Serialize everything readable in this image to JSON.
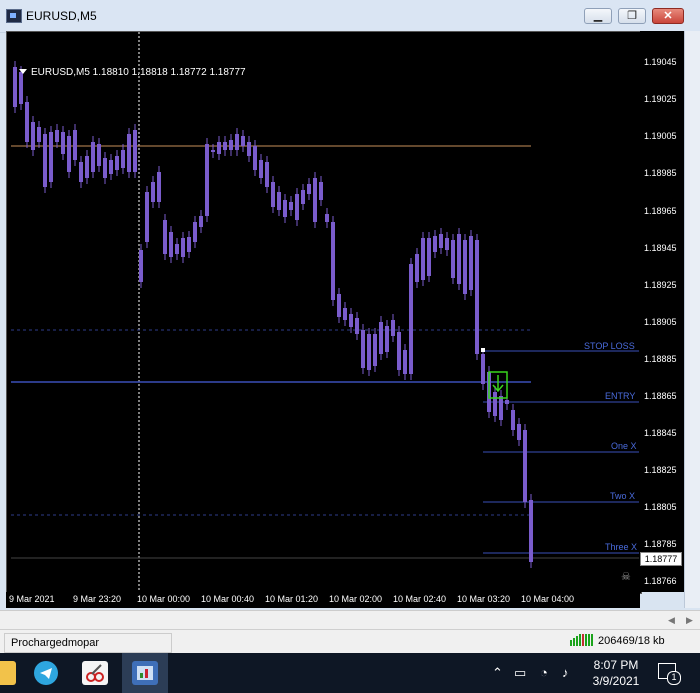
{
  "window": {
    "title": "EURUSD,M5",
    "minimize": "▁",
    "maximize": "❐",
    "close": "✕"
  },
  "chart": {
    "symbol_header": "EURUSD,M5  1.18810 1.18818 1.18772 1.18777",
    "current_price": "1.18777",
    "price_ticks": [
      "1.19045",
      "1.19025",
      "1.19005",
      "1.18985",
      "1.18965",
      "1.18945",
      "1.18925",
      "1.18905",
      "1.18885",
      "1.18865",
      "1.18845",
      "1.18825",
      "1.18805",
      "1.18785",
      "1.18766"
    ],
    "time_ticks": [
      "9 Mar 2021",
      "9 Mar 23:20",
      "10 Mar 00:00",
      "10 Mar 00:40",
      "10 Mar 01:20",
      "10 Mar 02:00",
      "10 Mar 02:40",
      "10 Mar 03:20",
      "10 Mar 04:00"
    ],
    "levels": {
      "stop_loss": "STOP LOSS",
      "entry": "ENTRY",
      "one_x": "One X",
      "two_x": "Two X",
      "three_x": "Three X"
    },
    "colors": {
      "candle": "#7a5ccc",
      "hline_orange": "#c8905a",
      "level_blue": "#3a4fb8",
      "signal_green": "#39d41e"
    }
  },
  "status": {
    "profile": "Prochargedmopar",
    "traffic": "206469/18 kb"
  },
  "taskbar": {
    "time": "8:07 PM",
    "date": "3/9/2021",
    "notifications": "1"
  }
}
